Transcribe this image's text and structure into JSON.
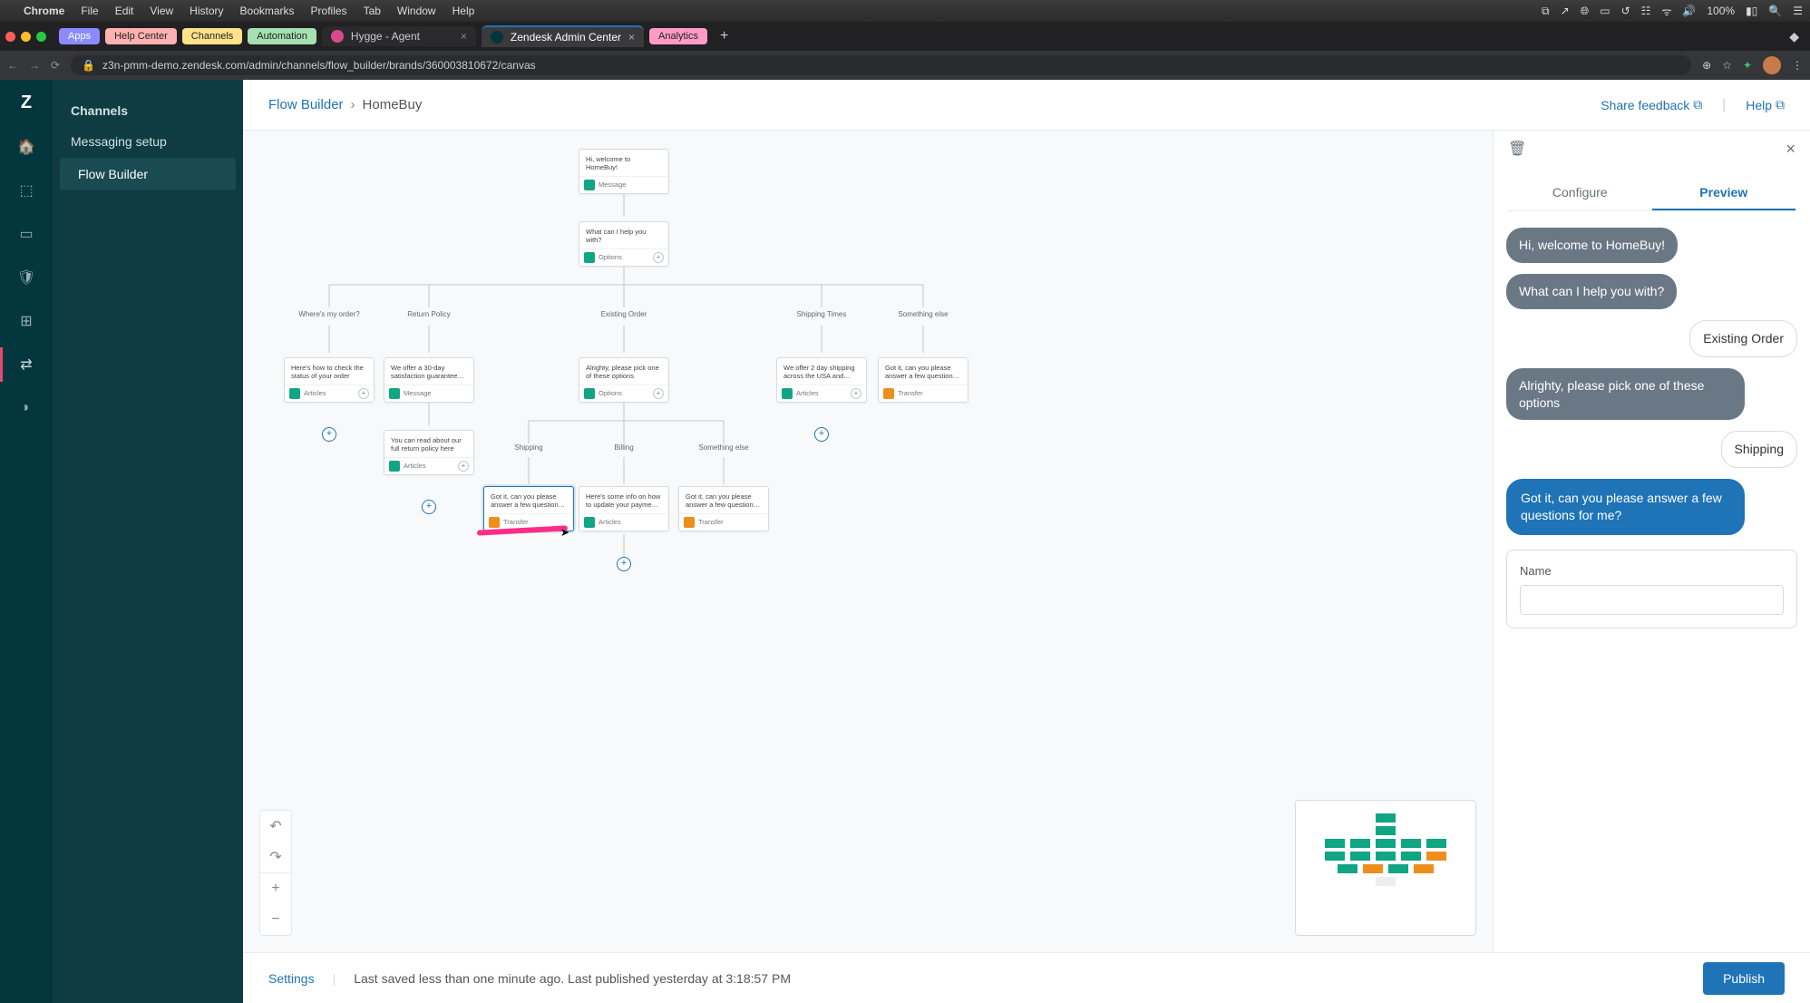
{
  "menubar": {
    "app": "Chrome",
    "items": [
      "File",
      "Edit",
      "View",
      "History",
      "Bookmarks",
      "Profiles",
      "Tab",
      "Window",
      "Help"
    ],
    "battery": "100%"
  },
  "bookmarks": {
    "apps": "Apps",
    "help": "Help Center",
    "channels": "Channels",
    "automation": "Automation",
    "analytics": "Analytics"
  },
  "tabs": {
    "t1": "Hygge - Agent",
    "t2": "Zendesk Admin Center"
  },
  "url": "z3n-pmm-demo.zendesk.com/admin/channels/flow_builder/brands/360003810672/canvas",
  "sidebar": {
    "header": "Channels",
    "messaging": "Messaging setup",
    "flow": "Flow Builder"
  },
  "crumbs": {
    "root": "Flow Builder",
    "current": "HomeBuy",
    "share": "Share feedback",
    "help": "Help"
  },
  "nodes": {
    "n1": "Hi, welcome to HomeBuy!",
    "n1f": "Message",
    "n2": "What can I help you with?",
    "n2f": "Options",
    "opt1": "Where's my order?",
    "opt2": "Return Policy",
    "opt3": "Existing Order",
    "opt4": "Shipping Times",
    "opt5": "Something else",
    "c1": "Here's how to check the status of your order",
    "c1f": "Articles",
    "c2": "We offer a 30-day satisfaction guarantee…",
    "c2f": "Message",
    "c3": "Alrighty, please pick one of these options",
    "c3f": "Options",
    "c4": "We offer 2 day shipping across the USA and…",
    "c4f": "Articles",
    "c5": "Got it, can you please answer a few question…",
    "c5f": "Transfer",
    "c6": "You can read about our full return policy here",
    "c6f": "Articles",
    "sub1": "Shipping",
    "sub2": "Billing",
    "sub3": "Something else",
    "d1": "Got it, can you please answer a few question…",
    "d1f": "Transfer",
    "d2": "Here's some info on how to update your payme…",
    "d2f": "Articles",
    "d3": "Got it, can you please answer a few question…",
    "d3f": "Transfer"
  },
  "panel": {
    "tab1": "Configure",
    "tab2": "Preview"
  },
  "chat": {
    "m1": "Hi, welcome to HomeBuy!",
    "m2": "What can I help you with?",
    "u1": "Existing Order",
    "m3": "Alrighty, please pick one of these options",
    "u2": "Shipping",
    "m4": "Got it, can you please answer a few questions for me?",
    "formLabel": "Name"
  },
  "footer": {
    "settings": "Settings",
    "status": "Last saved less than one minute ago. Last published yesterday at 3:18:57 PM",
    "publish": "Publish"
  }
}
